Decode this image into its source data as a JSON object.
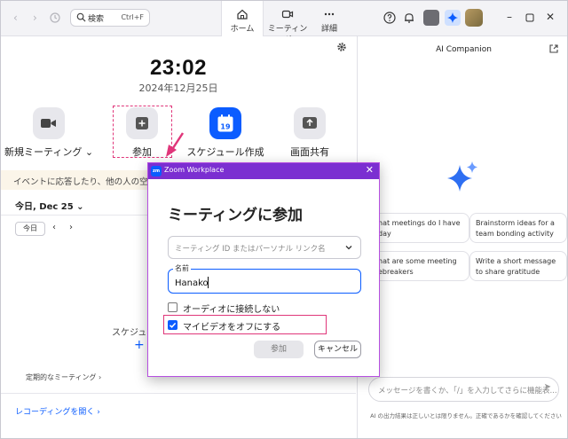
{
  "topbar": {
    "search_label": "検索",
    "search_shortcut": "Ctrl+F",
    "tabs": [
      {
        "label": "ホーム",
        "icon": "home-icon",
        "active": true
      },
      {
        "label": "ミーティング",
        "icon": "video-icon",
        "active": false
      },
      {
        "label": "詳細",
        "icon": "more-icon",
        "active": false
      }
    ]
  },
  "home": {
    "time": "23:02",
    "date": "2024年12月25日",
    "actions": [
      {
        "label": "新規ミーティング ⌄",
        "icon": "video-camera-icon"
      },
      {
        "label": "参加",
        "icon": "plus-icon"
      },
      {
        "label": "スケジュール作成",
        "icon": "calendar-icon",
        "calendar_day": "19"
      },
      {
        "label": "画面共有",
        "icon": "share-screen-icon"
      }
    ],
    "notice": "イベントに応答したり、他の人の空き状況",
    "today_label": "今日, Dec 25 ⌄",
    "today_button": "今日",
    "schedule_label": "スケジュール",
    "plus_symbol": "+",
    "regular_meetings": "定期的なミーティング ›",
    "open_recordings": "レコーディングを開く ›"
  },
  "ai": {
    "title": "AI Companion",
    "cards": [
      "hat meetings do I have day",
      "Brainstorm ideas for a team bonding activity",
      "hat are some meeting ebreakers",
      "Write a short message to share gratitude"
    ],
    "message_placeholder": "メッセージを書くか、「/」を入力してさらに機能表...",
    "disclaimer": "AI の出力結果は正しいとは限りません。正確であるかを確認してください"
  },
  "dialog": {
    "window_title": "Zoom Workplace",
    "logo_text": "zm",
    "heading": "ミーティングに参加",
    "meeting_id_placeholder": "ミーティング ID またはパーソナル リンク名",
    "name_label": "名前",
    "name_value": "Hanako",
    "no_audio_label": "オーディオに接続しない",
    "no_audio_checked": false,
    "video_off_label": "マイビデオをオフにする",
    "video_off_checked": true,
    "join_button": "参加",
    "cancel_button": "キャンセル"
  },
  "colors": {
    "accent": "#0b5cff",
    "dialog_titlebar": "#7b2fd1",
    "highlight": "#e0367a"
  }
}
